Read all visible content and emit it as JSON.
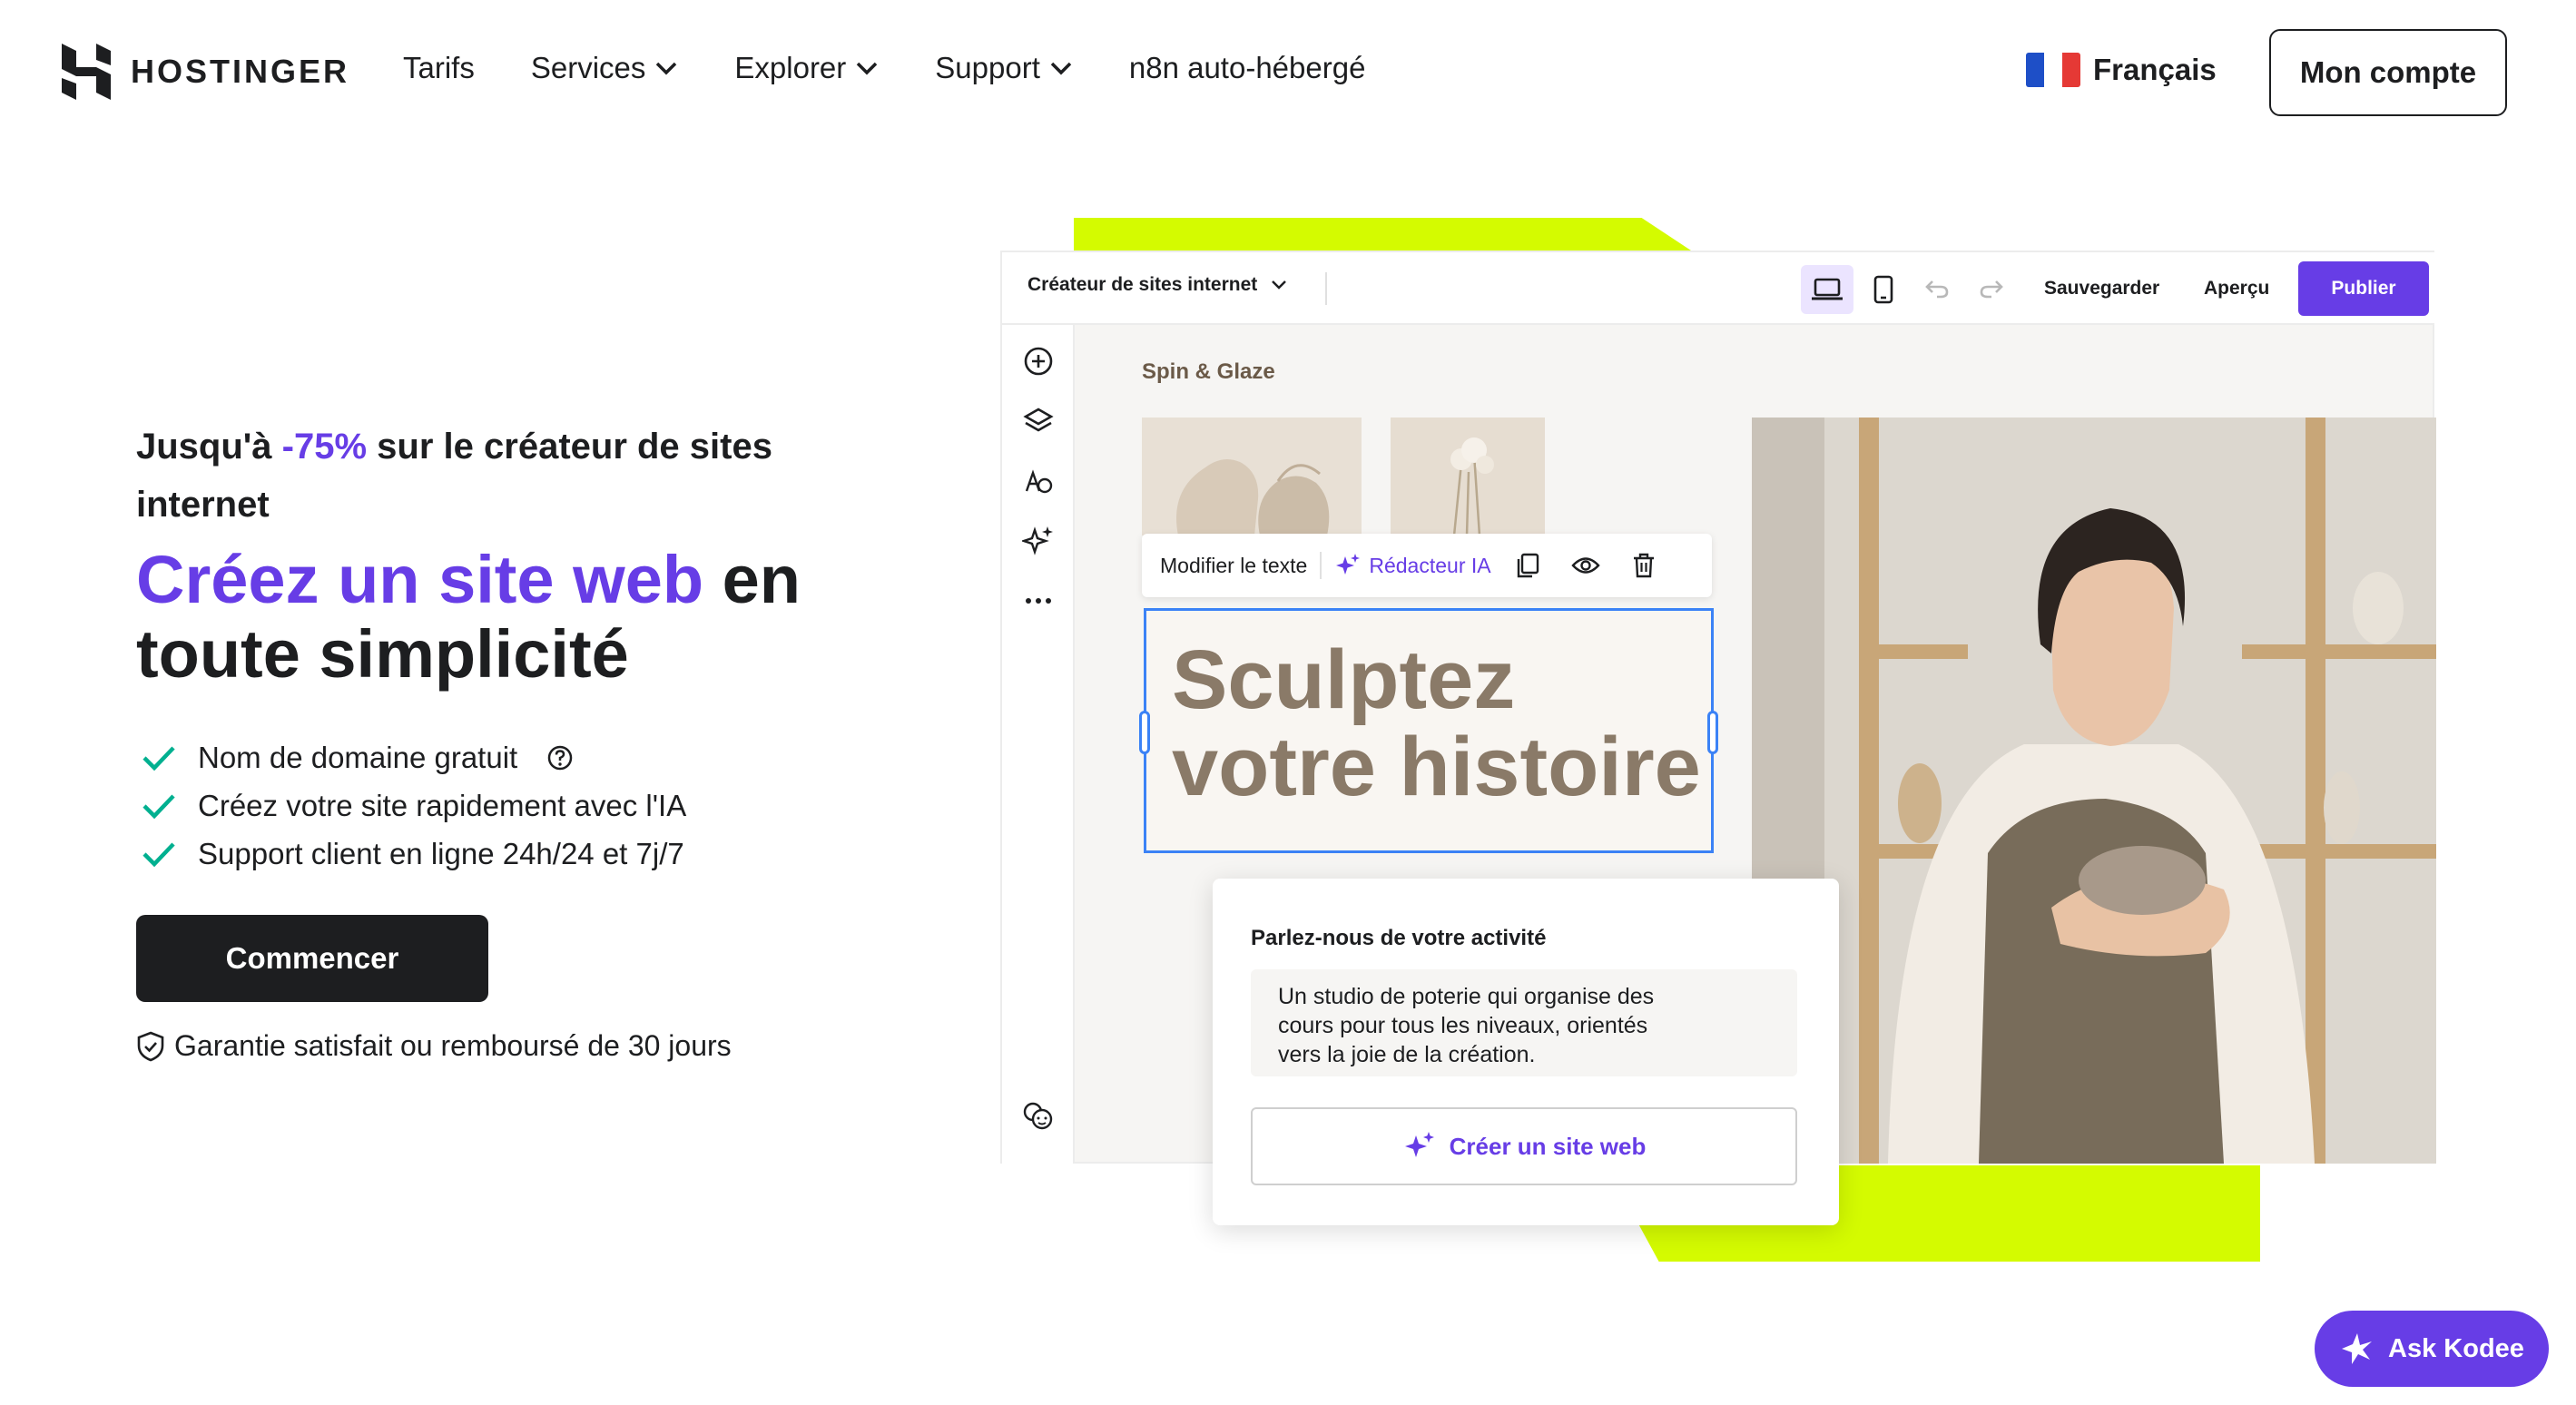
{
  "header": {
    "logo_text": "HOSTINGER",
    "nav": [
      "Tarifs",
      "Services",
      "Explorer",
      "Support",
      "n8n auto-hébergé"
    ],
    "language": "Français",
    "account": "Mon compte"
  },
  "hero": {
    "promo_pre": "Jusqu'à ",
    "promo_pct": "-75%",
    "promo_post": " sur le créateur de sites internet",
    "headline_accent": "Créez un site web",
    "headline_rest": " en toute simplicité",
    "features": [
      "Nom de domaine gratuit",
      "Créez votre site rapidement avec l'IA",
      "Support client en ligne 24h/24 et 7j/7"
    ],
    "cta": "Commencer",
    "guarantee": "Garantie satisfait ou remboursé de 30 jours"
  },
  "builder": {
    "site_selector": "Créateur de sites internet",
    "save": "Sauvegarder",
    "preview": "Aperçu",
    "publish": "Publier",
    "brand": "Spin & Glaze",
    "edit_text": "Modifier le texte",
    "ai_writer": "Rédacteur IA",
    "headline_line1": "Sculptez",
    "headline_line2": "votre histoire",
    "ai_panel_title": "Parlez-nous de votre activité",
    "ai_panel_input": "Un studio de poterie qui organise des\ncours pour tous les niveaux, orientés\nvers la joie de la création.",
    "ai_panel_button": "Créer un site web"
  },
  "assistant": {
    "label": "Ask Kodee"
  },
  "colors": {
    "accent": "#673de6",
    "dark": "#1d1e20",
    "lime": "#d4fb00",
    "check": "#00b090"
  }
}
